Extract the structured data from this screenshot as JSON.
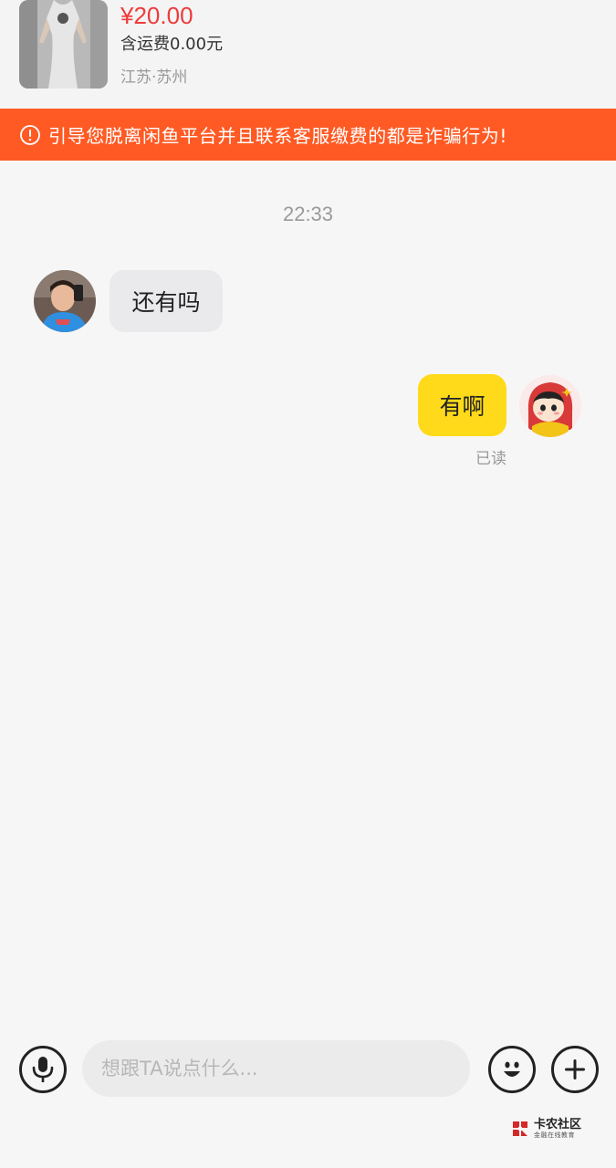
{
  "product": {
    "price": "¥20.00",
    "shipping": "含运费0.00元",
    "location": "江苏·苏州"
  },
  "warning": {
    "text": "引导您脱离闲鱼平台并且联系客服缴费的都是诈骗行为!",
    "icon": "alert-circle-icon",
    "color": "#ff5a24"
  },
  "chat": {
    "timestamp": "22:33",
    "messages": [
      {
        "side": "left",
        "text": "还有吗"
      },
      {
        "side": "right",
        "text": "有啊",
        "status": "已读"
      }
    ]
  },
  "composer": {
    "placeholder": "想跟TA说点什么...",
    "voice_icon": "microphone-icon",
    "emoji_icon": "emoji-icon",
    "more_icon": "plus-icon"
  },
  "watermark": {
    "title": "卡农社区",
    "subtitle": "金融在线教育"
  },
  "colors": {
    "price": "#ee3b3b",
    "my_bubble": "#ffda1a",
    "their_bubble": "#eaeaec"
  }
}
